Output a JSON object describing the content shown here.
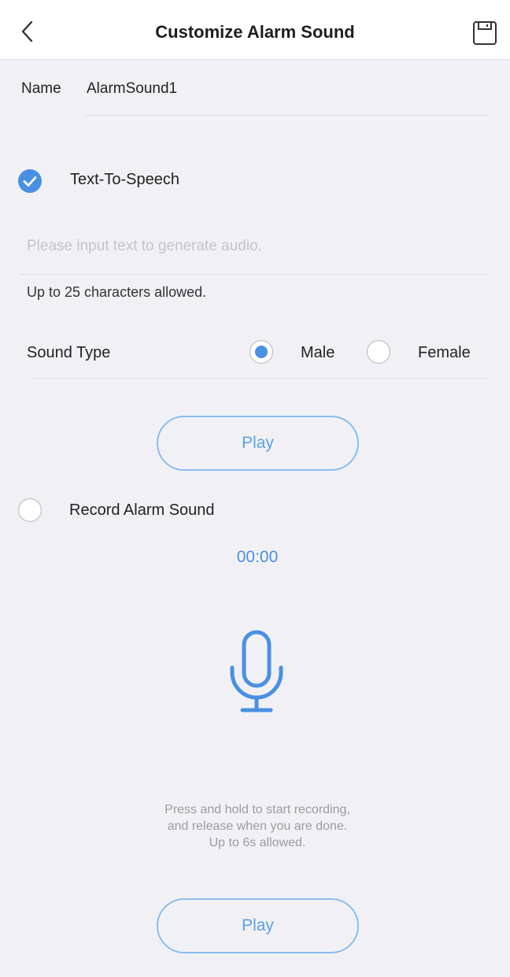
{
  "header": {
    "title": "Customize Alarm Sound",
    "back_icon": "chevron-left-icon",
    "save_icon": "save-icon"
  },
  "name": {
    "label": "Name",
    "value": "AlarmSound1"
  },
  "tts": {
    "label": "Text-To-Speech",
    "checked": true,
    "input_placeholder": "Please input text to generate audio.",
    "input_value": "",
    "hint": "Up to 25 characters allowed."
  },
  "sound_type": {
    "label": "Sound Type",
    "options": [
      "Male",
      "Female"
    ],
    "selected": "Male"
  },
  "play_label": "Play",
  "record": {
    "label": "Record Alarm Sound",
    "selected": false,
    "timer": "00:00",
    "mic_icon": "microphone-icon",
    "instructions": "Press and hold to start recording, and release when you are done.",
    "limit": "Up to 6s allowed."
  },
  "colors": {
    "accent": "#4a90e2",
    "button_border": "#88bdf0",
    "background": "#f1f1f5"
  }
}
